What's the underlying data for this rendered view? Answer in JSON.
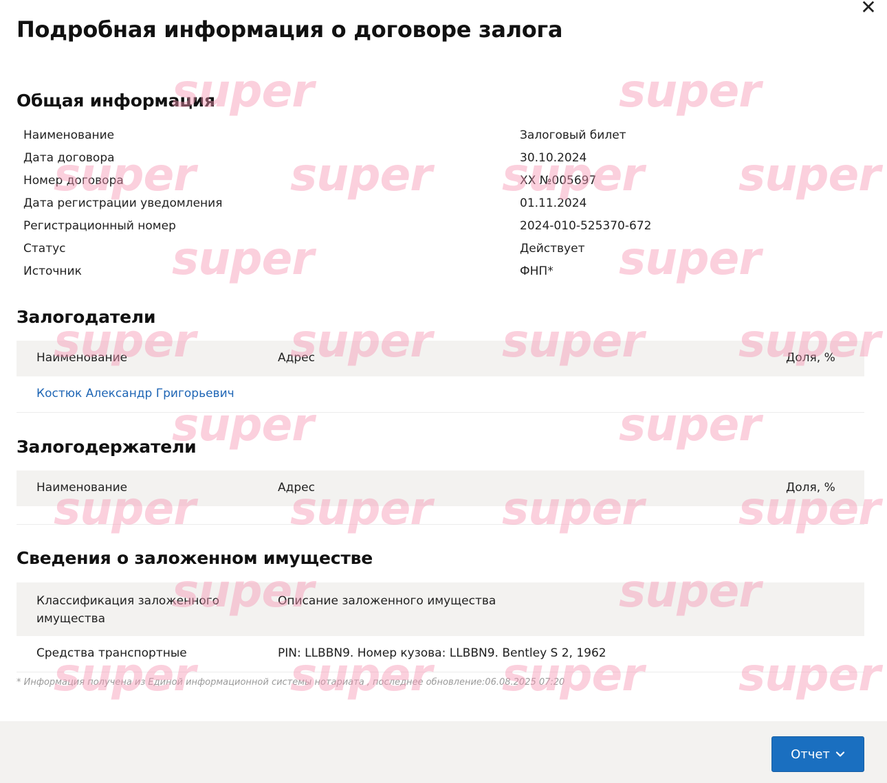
{
  "modal": {
    "title": "Подробная информация о договоре залога",
    "close_glyph": "✕"
  },
  "general": {
    "title": "Общая информация",
    "rows": [
      {
        "label": "Наименование",
        "value": "Залоговый билет"
      },
      {
        "label": "Дата договора",
        "value": "30.10.2024"
      },
      {
        "label": "Номер договора",
        "value": "XX №005697"
      },
      {
        "label": "Дата регистрации уведомления",
        "value": "01.11.2024"
      },
      {
        "label": "Регистрационный номер",
        "value": "2024-010-525370-672"
      },
      {
        "label": "Статус",
        "value": "Действует"
      },
      {
        "label": "Источник",
        "value": "ФНП*"
      }
    ]
  },
  "pledgors": {
    "title": "Залогодатели",
    "columns": [
      "Наименование",
      "Адрес",
      "Доля, %"
    ],
    "rows": [
      {
        "name": "Костюк Александр Григорьевич",
        "address": "",
        "share": ""
      }
    ]
  },
  "pledgees": {
    "title": "Залогодержатели",
    "columns": [
      "Наименование",
      "Адрес",
      "Доля, %"
    ]
  },
  "property": {
    "title": "Сведения о заложенном имуществе",
    "columns": [
      "Классификация заложенного имущества",
      "Описание заложенного имущества"
    ],
    "rows": [
      {
        "classification": "Средства транспортные",
        "description": "PIN: LLBBN9. Номер кузова: LLBBN9. Bentley S 2, 1962"
      }
    ]
  },
  "footnote": "* Информация получена из Единой информационной системы нотариата , последнее обновление:06.08.2025 07:20",
  "footer": {
    "report_label": "Отчет"
  },
  "watermark_text": "super",
  "colors": {
    "link": "#1f66b5",
    "button": "#1a6fc0",
    "watermark": "#f796b4",
    "table_header_bg": "#f3f2f0"
  }
}
